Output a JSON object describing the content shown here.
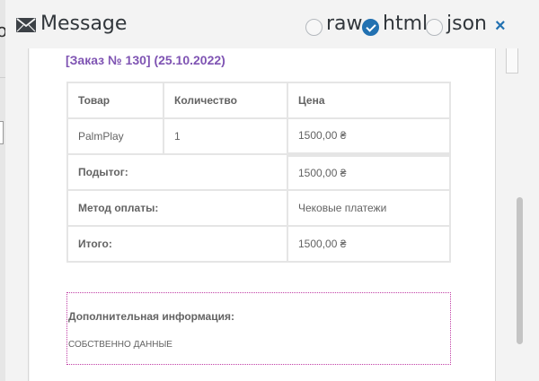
{
  "background": {
    "fragment": "og"
  },
  "header": {
    "title": "Message",
    "options": [
      {
        "label": "raw",
        "checked": false
      },
      {
        "label": "html",
        "checked": true
      },
      {
        "label": "json",
        "checked": false
      }
    ],
    "close_label": "×"
  },
  "email": {
    "order_title": "[Заказ № 130] (25.10.2022)",
    "table": {
      "headers": [
        "Товар",
        "Количество",
        "Цена"
      ],
      "rows": [
        [
          "PalmPlay",
          "1",
          "1500,00 ₴"
        ]
      ],
      "totals": [
        {
          "label": "Подытог:",
          "value": "1500,00 ₴"
        },
        {
          "label": "Метод оплаты:",
          "value": "Чековые платежи"
        },
        {
          "label": "Итого:",
          "value": "1500,00 ₴"
        }
      ]
    },
    "additional": {
      "label": "Дополнительная информация:",
      "text": "СОБСТВЕННО ДАННЫЕ"
    }
  },
  "colors": {
    "accent": "#2271b1",
    "order_title": "#7f54b3",
    "dotted_border": "#c13fa6"
  }
}
